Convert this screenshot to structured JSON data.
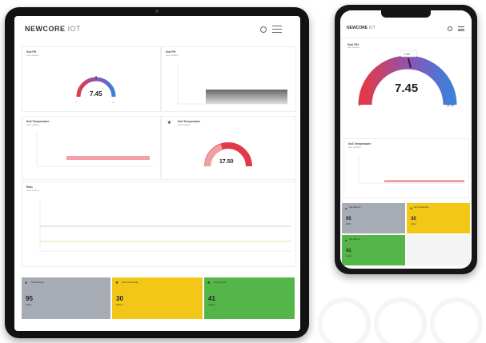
{
  "brand": {
    "name": "NEWCORE",
    "suffix": "IOT"
  },
  "tablet": {
    "ph_card": {
      "title": "Soil PH",
      "subtitle": "Last reading",
      "value": "7.45",
      "gauge_fraction": 0.5
    },
    "bar_card": {
      "title": "Soil PH",
      "subtitle": "Last reading"
    },
    "temp_chart_card": {
      "title": "Soil Temperature",
      "subtitle": "Last reading"
    },
    "temp_gauge_card": {
      "title": "Soil Temperature",
      "subtitle": "Last reading",
      "value": "17.50",
      "gauge_fraction": 0.55
    },
    "rain_card": {
      "title": "Rain",
      "subtitle": "Last reading"
    },
    "tiles": [
      {
        "icon": "droplet-icon",
        "label": "Soil Moisture",
        "value": "95",
        "unit": "%RH",
        "color": "#a7abb3"
      },
      {
        "icon": "leaf-icon",
        "label": "Soil Conductivity",
        "value": "30",
        "unit": "uS/cm",
        "color": "#f2c718"
      },
      {
        "icon": "sprout-icon",
        "label": "Soil Nitrogen",
        "value": "41",
        "unit": "mg/kg",
        "color": "#54b649"
      }
    ]
  },
  "phone": {
    "ph_card": {
      "title": "Soil PH",
      "subtitle": "Last reading",
      "value": "7.45",
      "needle_label": "7.00",
      "min_label": "0",
      "max_label": "14.00",
      "gauge_fraction": 0.53
    },
    "temp_chart_card": {
      "title": "Soil Temperature",
      "subtitle": "Last reading"
    },
    "tiles": [
      {
        "icon": "droplet-icon",
        "label": "Soil Moisture",
        "value": "95",
        "unit": "%RH",
        "color": "#a7abb3"
      },
      {
        "icon": "leaf-icon",
        "label": "Soil Conductivity",
        "value": "30",
        "unit": "uS/cm",
        "color": "#f2c718"
      },
      {
        "icon": "sprout-icon",
        "label": "Soil Nitrogen",
        "value": "41",
        "unit": "mg/kg",
        "color": "#54b649"
      },
      {
        "icon": "",
        "label": "",
        "value": "",
        "unit": "",
        "color": "#f4f4f4"
      }
    ]
  },
  "colors": {
    "gauge_red": "#e03a4a",
    "gauge_purple": "#8a55b8",
    "gauge_blue": "#3d7fd9",
    "temp_line": "#f4a0a8"
  }
}
